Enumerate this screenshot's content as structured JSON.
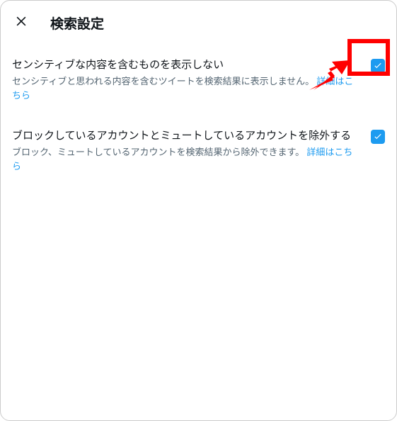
{
  "header": {
    "title": "検索設定"
  },
  "settings": [
    {
      "label": "センシティブな内容を含むものを表示しない",
      "desc": "センシティブと思われる内容を含むツイートを検索結果に表示しません。",
      "link": "詳細はこちら"
    },
    {
      "label": "ブロックしているアカウントとミュートしているアカウントを除外する",
      "desc": "ブロック、ミュートしているアカウントを検索結果から除外できます。",
      "link": "詳細はこちら"
    }
  ]
}
